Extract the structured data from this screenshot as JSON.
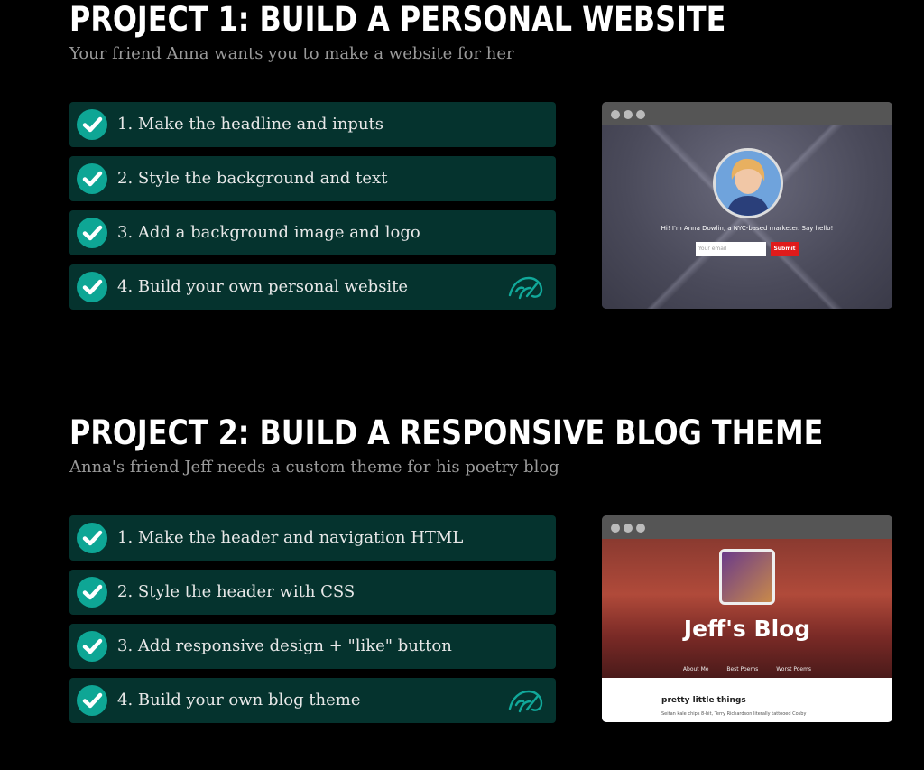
{
  "colors": {
    "task_bg": "#05332e",
    "check": "#0ea695",
    "submit": "#e01b1b"
  },
  "projects": [
    {
      "title": "PROJECT 1: BUILD A PERSONAL WEBSITE",
      "subtitle": "Your friend Anna wants you to make a website for her",
      "tasks": [
        {
          "label": "1. Make the headline and inputs",
          "icon": "check-icon"
        },
        {
          "label": "2. Style the background and text",
          "icon": "check-icon"
        },
        {
          "label": "3. Add a background image and logo",
          "icon": "check-icon"
        },
        {
          "label": "4. Build your own personal website",
          "icon": "check-icon",
          "extra_icon": "bird-logo-icon"
        }
      ],
      "preview": {
        "intro": "Hi! I'm Anna Dowlin, a NYC-based marketer. Say hello!",
        "input_placeholder": "Your email",
        "submit_label": "Submit"
      }
    },
    {
      "title": "PROJECT 2: BUILD A RESPONSIVE BLOG THEME",
      "subtitle": "Anna's friend Jeff needs a custom theme for his poetry blog",
      "tasks": [
        {
          "label": "1. Make the header and navigation HTML",
          "icon": "check-icon"
        },
        {
          "label": "2. Style the header with CSS",
          "icon": "check-icon"
        },
        {
          "label": "3. Add responsive design + \"like\" button",
          "icon": "check-icon"
        },
        {
          "label": "4. Build your own blog theme",
          "icon": "check-icon",
          "extra_icon": "bird-logo-icon"
        }
      ],
      "preview": {
        "blog_title": "Jeff's Blog",
        "nav": [
          "About Me",
          "Best Poems",
          "Worst Poems"
        ],
        "post_title": "pretty little things",
        "post_excerpt": "Seitan kale chips 8-bit, Terry Richardson literally tattooed Cosby"
      }
    }
  ]
}
